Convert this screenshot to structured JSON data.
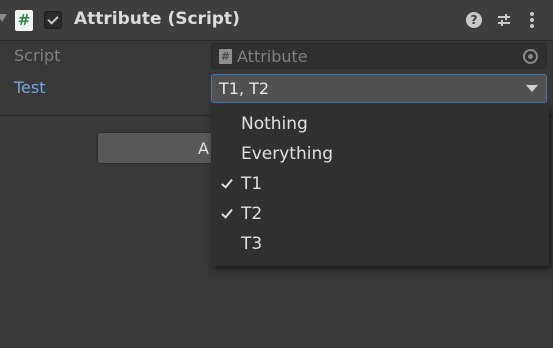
{
  "header": {
    "title": "Attribute (Script)",
    "script_icon_glyph": "#",
    "help_glyph": "?"
  },
  "fields": {
    "script": {
      "label": "Script",
      "value": "Attribute",
      "icon_glyph": "#"
    },
    "test": {
      "label": "Test",
      "value": "T1, T2"
    }
  },
  "add_component": {
    "label": "A"
  },
  "dropdown_menu": {
    "items": [
      {
        "label": "Nothing",
        "checked": false
      },
      {
        "label": "Everything",
        "checked": false
      },
      {
        "label": "T1",
        "checked": true
      },
      {
        "label": "T2",
        "checked": true
      },
      {
        "label": "T3",
        "checked": false
      }
    ]
  },
  "colors": {
    "background": "#383838",
    "header_background": "#3e3e3e",
    "label_highlight": "#74a6e2",
    "field_focus_border": "#3a79bb",
    "popup_background": "#303030"
  },
  "icons": [
    "foldout-arrow-icon",
    "script-icon",
    "help-icon",
    "presets-icon",
    "menu-icon",
    "object-picker-icon",
    "dropdown-arrow-icon",
    "checkmark-icon"
  ]
}
